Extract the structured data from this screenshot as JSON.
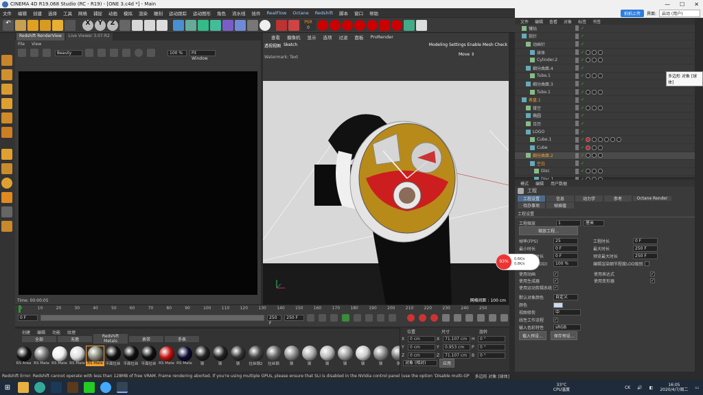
{
  "window": {
    "title": "CINEMA 4D R19.068 Studio (RC - R19) - [ONE 3.c4d *] - Main",
    "share": "拍拍上传",
    "layout_label": "界面:",
    "layout_value": "启动 (用户)"
  },
  "menus": [
    "文件",
    "编辑",
    "创建",
    "选择",
    "工具",
    "网格",
    "捕捉",
    "动画",
    "模拟",
    "渲染",
    "雕刻",
    "运动跟踪",
    "运动图形",
    "角色",
    "流水线",
    "插件",
    "RealFlow",
    "Octane",
    "Redshift",
    "脚本",
    "窗口",
    "帮助"
  ],
  "toolbar": {
    "axes": [
      "X",
      "Y",
      "Z"
    ],
    "psr": "PSR",
    "psr_value": "0"
  },
  "rs": {
    "tabs": [
      "Redshift RenderView",
      "Live Viewer 3.07-R2"
    ],
    "menu": [
      "File",
      "View"
    ],
    "aov": "Beauty",
    "zoom": "100 %",
    "fit": "Fit Window",
    "time": "Time: 00:00:05"
  },
  "viewport": {
    "menu": [
      "查看",
      "摄像机",
      "显示",
      "选项",
      "过滤",
      "面板",
      "ProRender"
    ],
    "label": "透视视图",
    "sketch": "Sketch",
    "mode": "Modeling Settings Enable Mesh Check",
    "watermark": "Watermark: Text",
    "move": "Move ⇕",
    "grid": "网格间距 : 100 cm"
  },
  "timeline": {
    "ticks": [
      "0",
      "10",
      "20",
      "30",
      "40",
      "50",
      "60",
      "70",
      "80",
      "90",
      "100",
      "110",
      "120",
      "130",
      "140",
      "150",
      "160",
      "170",
      "180",
      "190",
      "200",
      "210",
      "220",
      "230",
      "240",
      "250"
    ],
    "start": "0 F",
    "end": "250 F",
    "end2": "250 F",
    "cur": "0 F"
  },
  "materials": {
    "menu": [
      "创建",
      "编辑",
      "功能",
      "纹理"
    ],
    "tabs": [
      "全部",
      "无菌",
      "Redshift Metals",
      "表带",
      "手表"
    ],
    "labels": [
      "RS Area",
      "RS Mate",
      "RS Mate",
      "RS Mate",
      "RS Mate",
      "平面拉丝",
      "平面拉丝",
      "平面拉丝",
      "RS Mate",
      "RS Mate",
      "钢",
      "钢",
      "钢",
      "拉丝钢2",
      "拉丝钢",
      "钢",
      "钢",
      "钢",
      "钢",
      "钢",
      "钢",
      "钢"
    ]
  },
  "coords": {
    "headers": [
      "位置",
      "尺寸",
      "旋转"
    ],
    "rows": [
      [
        "X",
        "0 cm",
        "X",
        "71.107 cm",
        "H",
        "0 °"
      ],
      [
        "Y",
        "0 cm",
        "Y",
        "0.953 cm",
        "P",
        "0 °"
      ],
      [
        "Z",
        "0 cm",
        "Z",
        "71.107 cm",
        "B",
        "0 °"
      ]
    ],
    "mode": "对象 (相对)",
    "apply": "应用"
  },
  "objects": {
    "menu": [
      "文件",
      "编辑",
      "查看",
      "对象",
      "标签",
      "书签"
    ],
    "rows": [
      "镶钻",
      "指针",
      "动画针",
      "球体",
      "Cylinder.2",
      "细分曲面.4",
      "Tube.1",
      "细分曲面.3",
      "Tube.1",
      "表盘.1",
      "镂空",
      "椭圆",
      "日历",
      "LOGO",
      "Cube.1",
      "Cube",
      "细分曲面.2",
      "空白",
      "Disc",
      "Disc.1"
    ],
    "tooltip": "多边形 对象 [球体]"
  },
  "attr": {
    "menu": [
      "模式",
      "编辑",
      "用户数据"
    ],
    "title": "工程",
    "tabs1": [
      "工程设置",
      "信息",
      "动力学",
      "参考",
      "Octane Render"
    ],
    "tabs2": [
      "待办事项",
      "帧插值"
    ],
    "section": "工程设置",
    "scale_label": "工程缩放",
    "scale_value": "1",
    "scale_unit": "厘米",
    "scale_btn": "缩放工程...",
    "fps_label": "帧率(FPS)",
    "fps": "25",
    "min_label": "最小时长",
    "min": "0 F",
    "pmin_label": "预览最小时长",
    "pmin": "0 F",
    "len_label": "工程时长",
    "len": "0 F",
    "max_label": "最大时长",
    "max": "250 F",
    "pmax_label": "预览最大时长",
    "pmax": "250 F",
    "lod_label": "细节程度(LOD)",
    "lod": "100 %",
    "lod_render": "编辑渲染细节程度LOD级别",
    "chk": [
      "使用动画",
      "使用生成器",
      "使用运动剪辑系统",
      "使用表达式",
      "使用变形器"
    ],
    "color_label": "默认对象颜色",
    "color_value": "自定义",
    "color2": "颜色",
    "view_label": "视图修剪",
    "view_value": "中",
    "linear": "线性工作流程",
    "input_label": "输入色彩特性",
    "input_value": "sRGB",
    "load_btn": "载入预设...",
    "save_btn": "保存预设...",
    "tray": "93%",
    "net_up": "0.6K/s",
    "net_down": "0.8K/s"
  },
  "status": "Redshift Error: Redshift cannot operate with less than 128MB of free VRAM. Frame rendering aborted. If you're using multiple GPUs, please ensure that SLI is disabled in the NVidia control panel (use the option 'Disable multi-GPU mode')",
  "status_right": "多边形 对象 [球体]",
  "taskbar": {
    "temp": "33°C",
    "temp_label": "CPU温度",
    "time": "16:05",
    "date": "2020/4/7/周二",
    "lang": "CK"
  },
  "colors": {
    "accent": "#f0a030",
    "select": "#4d6b8c",
    "red": "#c0392b"
  }
}
